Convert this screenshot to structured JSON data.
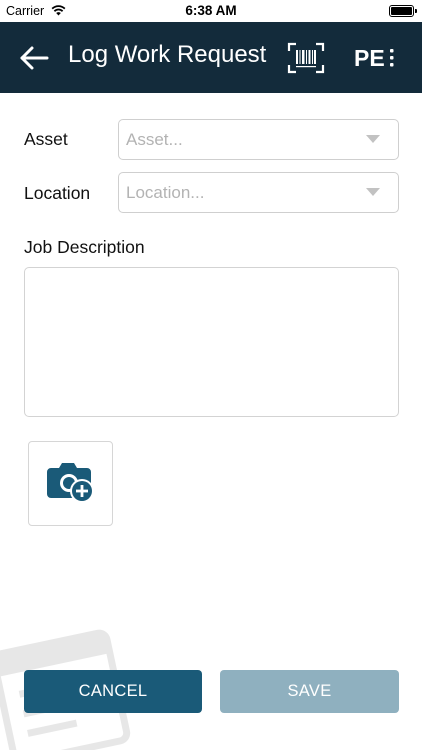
{
  "status_bar": {
    "carrier": "Carrier",
    "time": "6:38 AM"
  },
  "header": {
    "title": "Log Work Request",
    "logo_text": "PE",
    "background": "#132b3b"
  },
  "form": {
    "asset": {
      "label": "Asset",
      "placeholder": "Asset..."
    },
    "location": {
      "label": "Location",
      "placeholder": "Location..."
    },
    "job_description": {
      "label": "Job Description",
      "value": ""
    }
  },
  "actions": {
    "cancel_label": "CANCEL",
    "save_label": "SAVE",
    "cancel_color": "#1a5a78",
    "save_color": "#8fb0bf"
  },
  "icons": {
    "back": "arrow-left-icon",
    "barcode": "barcode-scan-icon",
    "camera": "camera-add-icon"
  }
}
